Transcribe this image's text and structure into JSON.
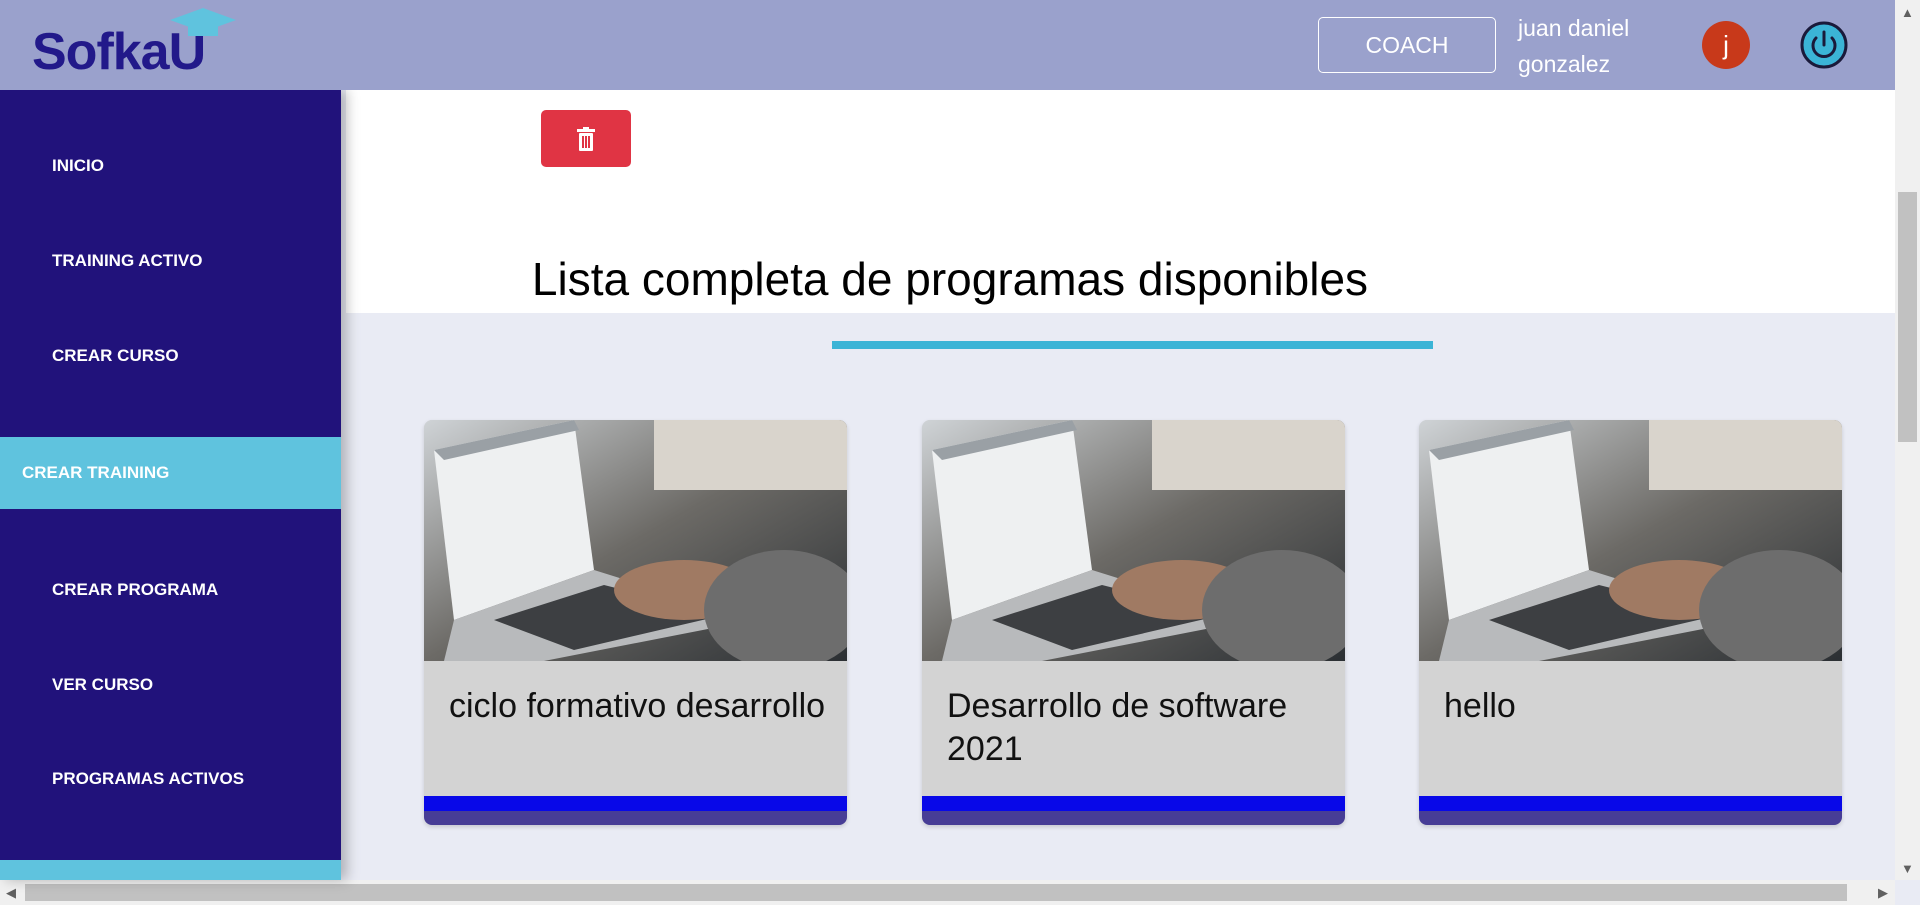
{
  "header": {
    "logo_text": "Sofka",
    "logo_letter": "U",
    "role_button": "COACH",
    "user_name_line1": "juan daniel",
    "user_name_line2": "gonzalez",
    "avatar_initial": "j",
    "brand_color": "#22198a",
    "header_bg": "#9aa1cc"
  },
  "sidebar": {
    "items": [
      {
        "label": "INICIO"
      },
      {
        "label": "TRAINING ACTIVO"
      },
      {
        "label": "CREAR CURSO"
      },
      {
        "label": "CREAR TRAINING",
        "active": true
      },
      {
        "label": "CREAR PROGRAMA"
      },
      {
        "label": "VER CURSO"
      },
      {
        "label": "PROGRAMAS ACTIVOS"
      }
    ],
    "bg_color": "#21127b",
    "active_color": "#5fc3de"
  },
  "main": {
    "delete_icon": "trash-icon",
    "section_title": "Lista completa de programas disponibles",
    "cards": [
      {
        "title": "ciclo formativo desarrollo"
      },
      {
        "title": "Desarrollo de software 2021"
      },
      {
        "title": "hello"
      }
    ]
  }
}
